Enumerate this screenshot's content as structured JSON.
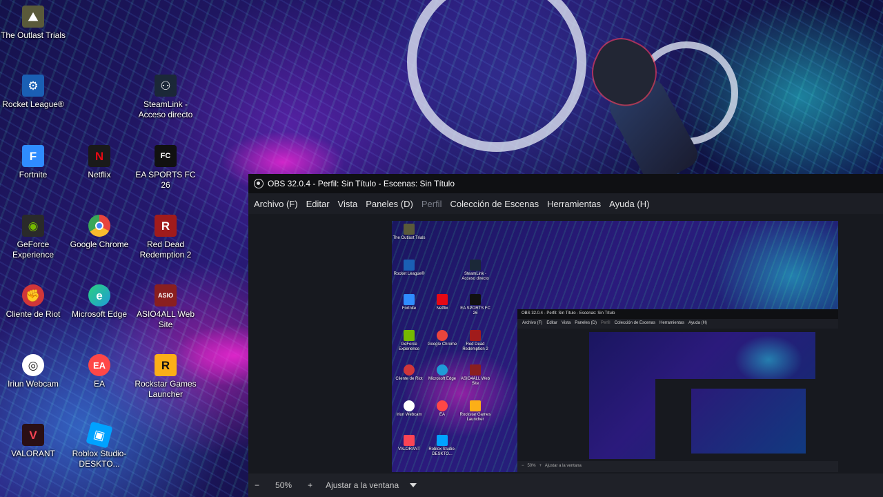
{
  "desktop": {
    "icons": [
      {
        "label": "The Outlast Trials",
        "icon": "outlast-icon",
        "color": "#5a5a3a"
      },
      {
        "label": "Rocket League®",
        "icon": "rocket-league-icon",
        "color": "#1a5fb4"
      },
      {
        "label": "SteamLink - Acceso directo",
        "icon": "steamlink-icon",
        "color": "#1b2838"
      },
      {
        "label": "Fortnite",
        "icon": "fortnite-icon",
        "color": "#2f8cff"
      },
      {
        "label": "Netflix",
        "icon": "netflix-icon",
        "color": "#e50914"
      },
      {
        "label": "EA SPORTS FC 26",
        "icon": "ea-fc-icon",
        "color": "#111111"
      },
      {
        "label": "GeForce Experience",
        "icon": "geforce-icon",
        "color": "#76b900"
      },
      {
        "label": "Google Chrome",
        "icon": "chrome-icon",
        "color": "#e8453c"
      },
      {
        "label": "Red Dead Redemption 2",
        "icon": "rdr2-icon",
        "color": "#a11b1b"
      },
      {
        "label": "Cliente de Riot",
        "icon": "riot-icon",
        "color": "#d13639"
      },
      {
        "label": "Microsoft Edge",
        "icon": "edge-icon",
        "color": "#1f9bd8"
      },
      {
        "label": "ASIO4ALL Web Site",
        "icon": "asio4all-icon",
        "color": "#8a1f1f"
      },
      {
        "label": "Iriun Webcam",
        "icon": "iriun-icon",
        "color": "#2a2a40"
      },
      {
        "label": "EA",
        "icon": "ea-icon",
        "color": "#ff4747"
      },
      {
        "label": "Rockstar Games Launcher",
        "icon": "rockstar-icon",
        "color": "#fcaf17"
      },
      {
        "label": "VALORANT",
        "icon": "valorant-icon",
        "color": "#fa4454"
      },
      {
        "label": "Roblox Studio-DESKTO...",
        "icon": "roblox-studio-icon",
        "color": "#00a2ff"
      }
    ]
  },
  "obs": {
    "title": "OBS 32.0.4 - Perfil: Sin Título - Escenas: Sin Título",
    "menu": {
      "archivo": "Archivo (F)",
      "editar": "Editar",
      "vista": "Vista",
      "paneles": "Paneles (D)",
      "perfil": "Perfil",
      "coleccion": "Colección de Escenas",
      "herramientas": "Herramientas",
      "ayuda": "Ayuda (H)"
    },
    "statusbar": {
      "minus": "−",
      "zoom": "50%",
      "plus": "+",
      "fit_label": "Ajustar a la ventana"
    }
  }
}
